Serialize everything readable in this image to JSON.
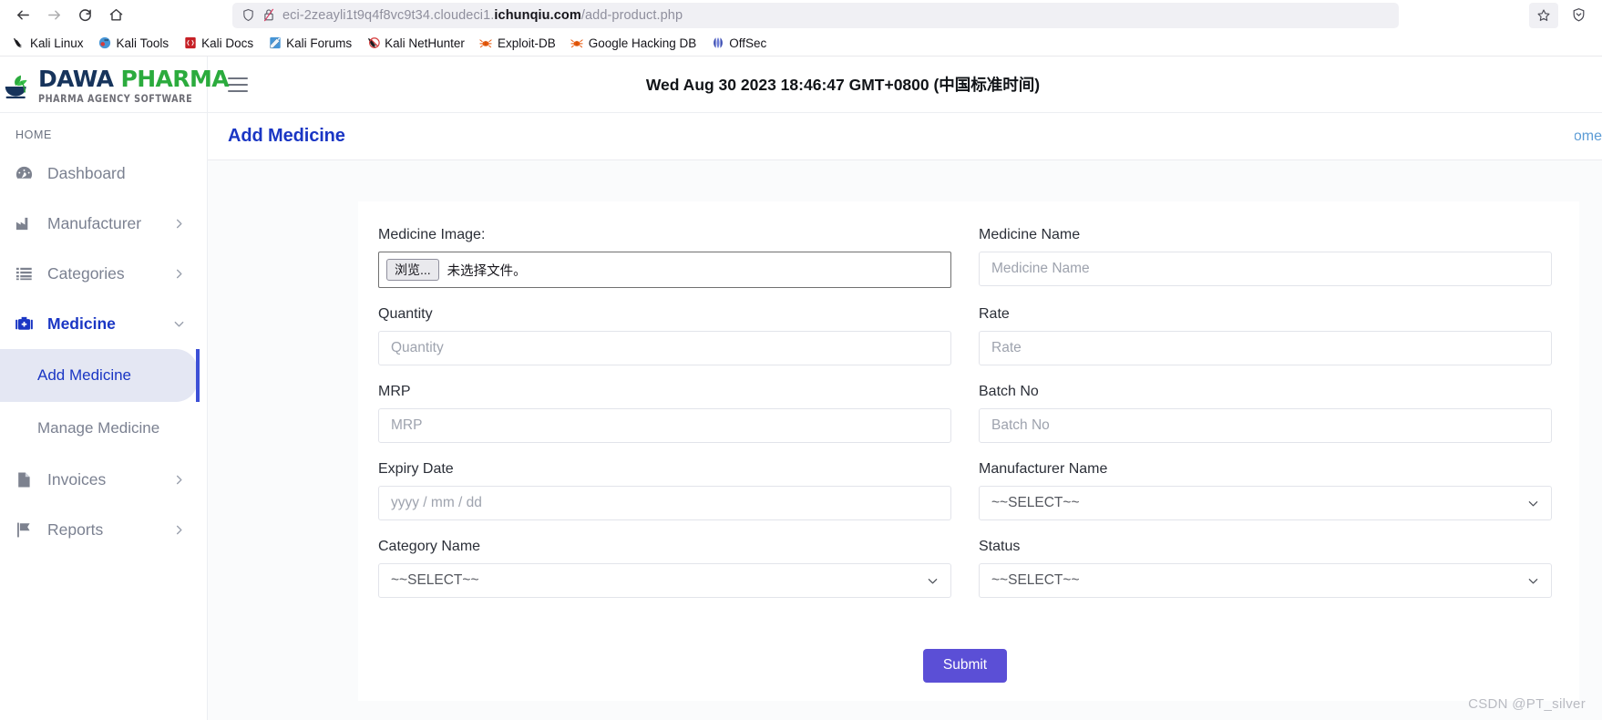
{
  "browser": {
    "nav": {
      "back": "Back",
      "forward": "Forward",
      "reload": "Reload",
      "home": "Home"
    },
    "url": {
      "prefix": "eci-2zeayli1t9q4f8vc9t34.cloudeci1.",
      "host": "ichunqiu.com",
      "path": "/add-product.php"
    },
    "bookmark_star": "Bookmark this page",
    "shield_label": "Tracking protection",
    "bookmarks": [
      {
        "label": "Kali Linux",
        "icon": "kali-dragon-icon"
      },
      {
        "label": "Kali Tools",
        "icon": "kali-tools-icon"
      },
      {
        "label": "Kali Docs",
        "icon": "kali-docs-icon"
      },
      {
        "label": "Kali Forums",
        "icon": "kali-forums-icon"
      },
      {
        "label": "Kali NetHunter",
        "icon": "kali-nethunter-icon"
      },
      {
        "label": "Exploit-DB",
        "icon": "exploit-db-icon"
      },
      {
        "label": "Google Hacking DB",
        "icon": "google-hacking-db-icon"
      },
      {
        "label": "OffSec",
        "icon": "offsec-icon"
      }
    ]
  },
  "brand": {
    "name_part1": "DAWA",
    "name_part2": "PHARMA",
    "tagline": "PHARMA AGENCY SOFTWARE",
    "color_dark": "#17345c",
    "color_green": "#2bab3d"
  },
  "sidebar": {
    "section_label": "HOME",
    "items": [
      {
        "label": "Dashboard",
        "icon": "dashboard-gauge-icon",
        "has_chevron": false,
        "active": false
      },
      {
        "label": "Manufacturer",
        "icon": "factory-icon",
        "has_chevron": true,
        "active": false
      },
      {
        "label": "Categories",
        "icon": "list-icon",
        "has_chevron": true,
        "active": false
      },
      {
        "label": "Medicine",
        "icon": "medical-kit-icon",
        "has_chevron": true,
        "active": true
      },
      {
        "label": "Invoices",
        "icon": "document-icon",
        "has_chevron": true,
        "active": false
      },
      {
        "label": "Reports",
        "icon": "flag-icon",
        "has_chevron": true,
        "active": false
      }
    ],
    "medicine_submenu": [
      {
        "label": "Add Medicine",
        "active": true
      },
      {
        "label": "Manage Medicine",
        "active": false
      }
    ],
    "active_accent": "#3d50d6"
  },
  "topbar": {
    "menu_toggle": "Toggle menu",
    "clock": "Wed Aug 30 2023 18:46:47 GMT+0800 (中国标准时间)"
  },
  "pagehead": {
    "title": "Add Medicine",
    "breadcrumb": "Home",
    "title_color": "#1a36c4"
  },
  "form": {
    "fields": {
      "medicine_image": {
        "label": "Medicine Image:",
        "browse_button": "浏览...",
        "file_status": "未选择文件。"
      },
      "medicine_name": {
        "label": "Medicine Name",
        "placeholder": "Medicine Name",
        "value": ""
      },
      "quantity": {
        "label": "Quantity",
        "placeholder": "Quantity",
        "value": ""
      },
      "rate": {
        "label": "Rate",
        "placeholder": "Rate",
        "value": ""
      },
      "mrp": {
        "label": "MRP",
        "placeholder": "MRP",
        "value": ""
      },
      "batch_no": {
        "label": "Batch No",
        "placeholder": "Batch No",
        "value": ""
      },
      "expiry_date": {
        "label": "Expiry Date",
        "placeholder": "yyyy / mm / dd",
        "value": ""
      },
      "manufacturer_name": {
        "label": "Manufacturer Name",
        "selected": "~~SELECT~~"
      },
      "category_name": {
        "label": "Category Name",
        "selected": "~~SELECT~~"
      },
      "status": {
        "label": "Status",
        "selected": "~~SELECT~~"
      }
    },
    "submit_label": "Submit",
    "submit_color": "#5b4fd6"
  },
  "watermark": "CSDN @PT_silver"
}
